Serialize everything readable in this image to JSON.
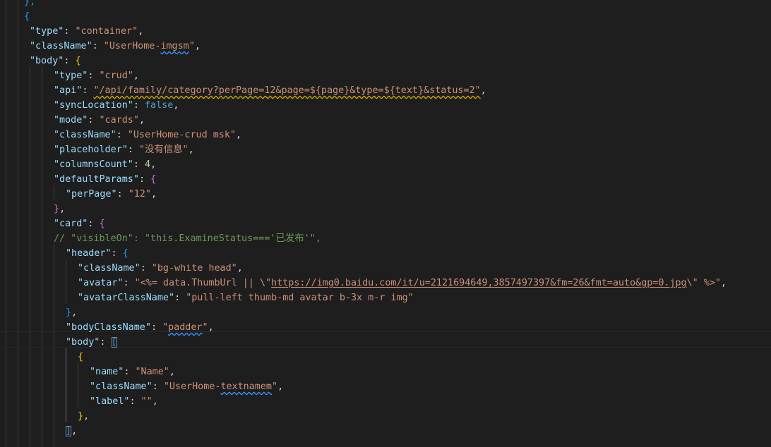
{
  "editor": {
    "language": "json",
    "lines": [
      {
        "indent": 34,
        "tokens": [
          {
            "t": "},",
            "c": "t-b3"
          }
        ]
      },
      {
        "indent": 34,
        "tokens": [
          {
            "t": "{",
            "c": "t-b3"
          }
        ]
      },
      {
        "indent": 42,
        "tokens": [
          {
            "t": "\"type\"",
            "c": "t-key"
          },
          {
            "t": ": ",
            "c": "t-pun"
          },
          {
            "t": "\"container\"",
            "c": "t-str"
          },
          {
            "t": ",",
            "c": "t-pun"
          }
        ]
      },
      {
        "indent": 42,
        "tokens": [
          {
            "t": "\"className\"",
            "c": "t-key"
          },
          {
            "t": ": ",
            "c": "t-pun"
          },
          {
            "t": "\"UserHome-",
            "c": "t-str"
          },
          {
            "t": "imgsm",
            "c": "t-str sq-b"
          },
          {
            "t": "\"",
            "c": "t-str"
          },
          {
            "t": ",",
            "c": "t-pun"
          }
        ]
      },
      {
        "indent": 42,
        "tokens": [
          {
            "t": "\"body\"",
            "c": "t-key"
          },
          {
            "t": ": ",
            "c": "t-pun"
          },
          {
            "t": "{",
            "c": "t-b1"
          }
        ]
      },
      {
        "indent": 76,
        "tokens": [
          {
            "t": "\"type\"",
            "c": "t-key"
          },
          {
            "t": ": ",
            "c": "t-pun"
          },
          {
            "t": "\"crud\"",
            "c": "t-str"
          },
          {
            "t": ",",
            "c": "t-pun"
          }
        ]
      },
      {
        "indent": 76,
        "tokens": [
          {
            "t": "\"api\"",
            "c": "t-key"
          },
          {
            "t": ": ",
            "c": "t-pun"
          },
          {
            "t": "\"/api/family/category?perPage=12&page=${page}&type=${text}&status=2\"",
            "c": "t-str sq-y"
          },
          {
            "t": ",",
            "c": "t-pun"
          }
        ]
      },
      {
        "indent": 76,
        "tokens": [
          {
            "t": "\"syncLocation\"",
            "c": "t-key"
          },
          {
            "t": ": ",
            "c": "t-pun"
          },
          {
            "t": "false",
            "c": "t-bool"
          },
          {
            "t": ",",
            "c": "t-pun"
          }
        ]
      },
      {
        "indent": 76,
        "tokens": [
          {
            "t": "\"mode\"",
            "c": "t-key"
          },
          {
            "t": ": ",
            "c": "t-pun"
          },
          {
            "t": "\"cards\"",
            "c": "t-str"
          },
          {
            "t": ",",
            "c": "t-pun"
          }
        ]
      },
      {
        "indent": 76,
        "tokens": [
          {
            "t": "\"className\"",
            "c": "t-key"
          },
          {
            "t": ": ",
            "c": "t-pun"
          },
          {
            "t": "\"UserHome-crud msk\"",
            "c": "t-str"
          },
          {
            "t": ",",
            "c": "t-pun"
          }
        ]
      },
      {
        "indent": 76,
        "tokens": [
          {
            "t": "\"placeholder\"",
            "c": "t-key"
          },
          {
            "t": ": ",
            "c": "t-pun"
          },
          {
            "t": "\"没有信息\"",
            "c": "t-str"
          },
          {
            "t": ",",
            "c": "t-pun"
          }
        ]
      },
      {
        "indent": 76,
        "tokens": [
          {
            "t": "\"columnsCount\"",
            "c": "t-key"
          },
          {
            "t": ": ",
            "c": "t-pun"
          },
          {
            "t": "4",
            "c": "t-num"
          },
          {
            "t": ",",
            "c": "t-pun"
          }
        ]
      },
      {
        "indent": 76,
        "tokens": [
          {
            "t": "\"defaultParams\"",
            "c": "t-key"
          },
          {
            "t": ": ",
            "c": "t-pun"
          },
          {
            "t": "{",
            "c": "t-b2"
          }
        ]
      },
      {
        "indent": 93,
        "tokens": [
          {
            "t": "\"perPage\"",
            "c": "t-key"
          },
          {
            "t": ": ",
            "c": "t-pun"
          },
          {
            "t": "\"12\"",
            "c": "t-str"
          },
          {
            "t": ",",
            "c": "t-pun"
          }
        ]
      },
      {
        "indent": 76,
        "tokens": [
          {
            "t": "}",
            "c": "t-b2"
          },
          {
            "t": ",",
            "c": "t-pun"
          }
        ]
      },
      {
        "indent": 76,
        "tokens": [
          {
            "t": "\"card\"",
            "c": "t-key"
          },
          {
            "t": ": ",
            "c": "t-pun"
          },
          {
            "t": "{",
            "c": "t-b2"
          }
        ]
      },
      {
        "indent": 76,
        "tokens": [
          {
            "t": "// \"visibleOn\": \"this.ExamineStatus==='已发布'\",",
            "c": "t-com"
          }
        ]
      },
      {
        "indent": 93,
        "tokens": [
          {
            "t": "\"header\"",
            "c": "t-key"
          },
          {
            "t": ": ",
            "c": "t-pun"
          },
          {
            "t": "{",
            "c": "t-b3"
          }
        ]
      },
      {
        "indent": 110,
        "tokens": [
          {
            "t": "\"className\"",
            "c": "t-key"
          },
          {
            "t": ": ",
            "c": "t-pun"
          },
          {
            "t": "\"bg-white head\"",
            "c": "t-str"
          },
          {
            "t": ",",
            "c": "t-pun"
          }
        ]
      },
      {
        "indent": 110,
        "tokens": [
          {
            "t": "\"avatar\"",
            "c": "t-key"
          },
          {
            "t": ": ",
            "c": "t-pun"
          },
          {
            "t": "\"<%= data.ThumbUrl || \\\"",
            "c": "t-str"
          },
          {
            "t": "https://img0.baidu.com/it/u=2121694649,3857497397&fm=26&fmt=auto&gp=0.jpg",
            "c": "t-str link"
          },
          {
            "t": "\\\" %>\"",
            "c": "t-str"
          },
          {
            "t": ",",
            "c": "t-pun"
          }
        ]
      },
      {
        "indent": 110,
        "tokens": [
          {
            "t": "\"avatarClassName\"",
            "c": "t-key"
          },
          {
            "t": ": ",
            "c": "t-pun"
          },
          {
            "t": "\"pull-left thumb-md avatar b-3x m-r img\"",
            "c": "t-str"
          }
        ]
      },
      {
        "indent": 93,
        "tokens": [
          {
            "t": "}",
            "c": "t-b3"
          },
          {
            "t": ",",
            "c": "t-pun"
          }
        ]
      },
      {
        "indent": 93,
        "tokens": [
          {
            "t": "\"bodyClassName\"",
            "c": "t-key"
          },
          {
            "t": ": ",
            "c": "t-pun"
          },
          {
            "t": "\"",
            "c": "t-str"
          },
          {
            "t": "padder",
            "c": "t-str sq-b"
          },
          {
            "t": "\"",
            "c": "t-str"
          },
          {
            "t": ",",
            "c": "t-pun"
          }
        ]
      },
      {
        "indent": 93,
        "tokens": [
          {
            "t": "\"body\"",
            "c": "t-key"
          },
          {
            "t": ": ",
            "c": "t-pun"
          },
          {
            "t": "[",
            "c": "t-b3 br-hl"
          }
        ]
      },
      {
        "indent": 110,
        "tokens": [
          {
            "t": "{",
            "c": "t-b1"
          }
        ]
      },
      {
        "indent": 127,
        "tokens": [
          {
            "t": "\"name\"",
            "c": "t-key"
          },
          {
            "t": ": ",
            "c": "t-pun"
          },
          {
            "t": "\"Name\"",
            "c": "t-str"
          },
          {
            "t": ",",
            "c": "t-pun"
          }
        ]
      },
      {
        "indent": 127,
        "tokens": [
          {
            "t": "\"className\"",
            "c": "t-key"
          },
          {
            "t": ": ",
            "c": "t-pun"
          },
          {
            "t": "\"UserHome-",
            "c": "t-str"
          },
          {
            "t": "textnamem",
            "c": "t-str sq-b"
          },
          {
            "t": "\"",
            "c": "t-str"
          },
          {
            "t": ",",
            "c": "t-pun"
          }
        ]
      },
      {
        "indent": 127,
        "tokens": [
          {
            "t": "\"label\"",
            "c": "t-key"
          },
          {
            "t": ": ",
            "c": "t-pun"
          },
          {
            "t": "\"\"",
            "c": "t-str"
          },
          {
            "t": ",",
            "c": "t-pun"
          }
        ]
      },
      {
        "indent": 110,
        "tokens": [
          {
            "t": "}",
            "c": "t-b1"
          },
          {
            "t": ",",
            "c": "t-pun"
          }
        ]
      },
      {
        "indent": 93,
        "tokens": [
          {
            "t": "]",
            "c": "t-b3 br-hl"
          },
          {
            "t": ",",
            "c": "t-pun"
          }
        ]
      }
    ]
  }
}
